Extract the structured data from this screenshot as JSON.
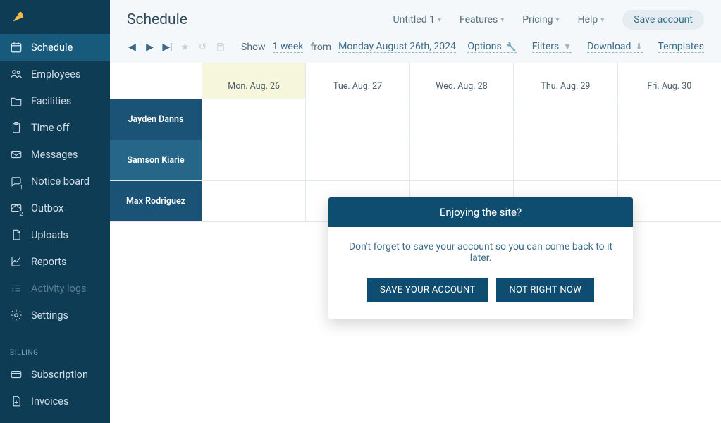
{
  "sidebar": {
    "items": [
      {
        "label": "Schedule",
        "icon": "calendar",
        "active": true
      },
      {
        "label": "Employees",
        "icon": "users"
      },
      {
        "label": "Facilities",
        "icon": "folder"
      },
      {
        "label": "Time off",
        "icon": "clipboard"
      },
      {
        "label": "Messages",
        "icon": "mail"
      },
      {
        "label": "Notice board",
        "icon": "chat",
        "badge": "1"
      },
      {
        "label": "Outbox",
        "icon": "send",
        "badge": "2"
      },
      {
        "label": "Uploads",
        "icon": "file"
      },
      {
        "label": "Reports",
        "icon": "chart"
      },
      {
        "label": "Activity logs",
        "icon": "list",
        "disabled": true
      },
      {
        "label": "Settings",
        "icon": "gear"
      }
    ],
    "billing_header": "BILLING",
    "billing_items": [
      {
        "label": "Subscription",
        "icon": "card"
      },
      {
        "label": "Invoices",
        "icon": "fileplus"
      }
    ]
  },
  "header": {
    "title": "Schedule",
    "doc": "Untitled 1",
    "features": "Features",
    "pricing": "Pricing",
    "help": "Help",
    "save": "Save account"
  },
  "toolbar": {
    "show": "Show",
    "range": "1 week",
    "from": "from",
    "date": "Monday August 26th, 2024",
    "options": "Options",
    "filters": "Filters",
    "download": "Download",
    "templates": "Templates"
  },
  "calendar": {
    "days": [
      "Mon. Aug. 26",
      "Tue. Aug. 27",
      "Wed. Aug. 28",
      "Thu. Aug. 29",
      "Fri. Aug. 30"
    ],
    "today_index": 0,
    "employees": [
      "Jayden Danns",
      "Samson Kiarie",
      "Max Rodriguez"
    ]
  },
  "modal": {
    "title": "Enjoying the site?",
    "body": "Don't forget to save your account so you can come back to it later.",
    "primary": "SAVE YOUR ACCOUNT",
    "secondary": "NOT RIGHT NOW"
  }
}
